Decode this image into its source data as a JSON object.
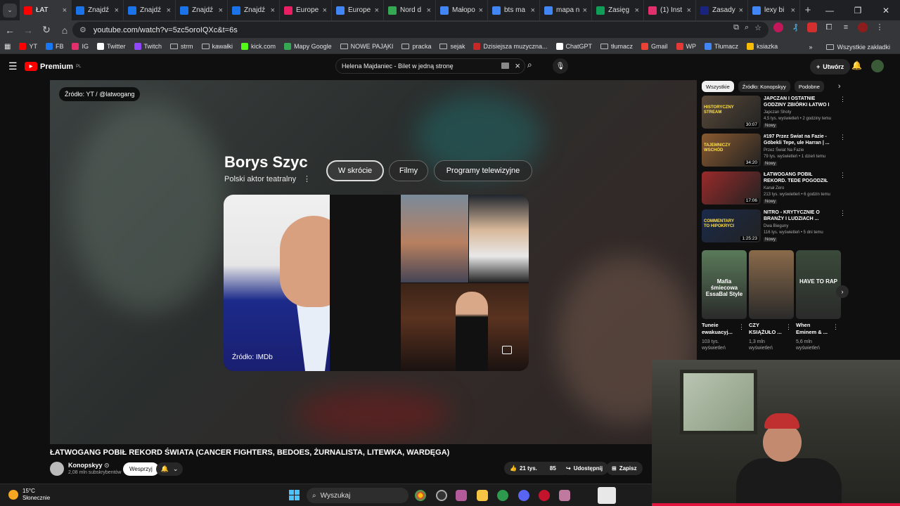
{
  "browser": {
    "tabs": [
      {
        "label": "ŁAT",
        "color": "#ff0000",
        "active": true
      },
      {
        "label": "Znajdź",
        "color": "#1a73e8"
      },
      {
        "label": "Znajdź",
        "color": "#1a73e8"
      },
      {
        "label": "Znajdź",
        "color": "#1a73e8"
      },
      {
        "label": "Znajdź",
        "color": "#1a73e8"
      },
      {
        "label": "Europe",
        "color": "#e91e63"
      },
      {
        "label": "Europe",
        "color": "#4285f4"
      },
      {
        "label": "Nord d",
        "color": "#34a853"
      },
      {
        "label": "Małopo",
        "color": "#4285f4"
      },
      {
        "label": "bts ma",
        "color": "#4285f4"
      },
      {
        "label": "mapa n",
        "color": "#4285f4"
      },
      {
        "label": "Zasięg",
        "color": "#0f9d58"
      },
      {
        "label": "(1) Inst",
        "color": "#e1306c"
      },
      {
        "label": "Zasady",
        "color": "#1a237e"
      },
      {
        "label": "lexy bi",
        "color": "#4285f4"
      }
    ],
    "url": "youtube.com/watch?v=5zc5oroIQXc&t=6s",
    "bookmarks": [
      {
        "label": "YT",
        "color": "#ff0000"
      },
      {
        "label": "FB",
        "color": "#1877f2"
      },
      {
        "label": "IG",
        "color": "#e1306c"
      },
      {
        "label": "Twitter",
        "color": "#ffffff"
      },
      {
        "label": "Twitch",
        "color": "#9146ff"
      },
      {
        "label": "strm",
        "color": "folder"
      },
      {
        "label": "kawałki",
        "color": "folder"
      },
      {
        "label": "kick.com",
        "color": "#53fc18"
      },
      {
        "label": "Mapy Google",
        "color": "#34a853"
      },
      {
        "label": "NOWE PAJĄKI",
        "color": "folder"
      },
      {
        "label": "pracka",
        "color": "folder"
      },
      {
        "label": "sejak",
        "color": "folder"
      },
      {
        "label": "Dzisiejsza muzyczna...",
        "color": "#c62828"
      },
      {
        "label": "ChatGPT",
        "color": "#ffffff"
      },
      {
        "label": "tłumacz",
        "color": "folder"
      },
      {
        "label": "Gmail",
        "color": "#ea4335"
      },
      {
        "label": "WP",
        "color": "#e53935"
      },
      {
        "label": "Tłumacz",
        "color": "#4285f4"
      },
      {
        "label": "ksiazka",
        "color": "#fbbc04"
      }
    ],
    "all_bookmarks": "Wszystkie zakładki"
  },
  "youtube": {
    "logo_text": "Premium",
    "logo_sup": "PL",
    "search_value": "Helena Majdaniec - Bilet w jedną stronę",
    "create_label": "Utwórz"
  },
  "player": {
    "source_chip": "Źródło: YT / @latwogang",
    "knowledge_panel": {
      "name": "Borys Szyc",
      "description": "Polski aktor teatralny",
      "tabs": [
        "W skrócie",
        "Filmy",
        "Programy telewizyjne"
      ],
      "image_caption": "Źródło: IMDb"
    }
  },
  "video": {
    "title": "ŁATWOGANG POBIŁ REKORD ŚWIATA (CANCER FIGHTERS, BEDOES, ŻURNALISTA, LITEWKA, WARDĘGA)",
    "channel": "Konopskyy",
    "subscribers": "2,08 mln subskrybentów",
    "support_label": "Wesprzyj",
    "likes": "21 tys.",
    "dislikes": "85",
    "share_label": "Udostępnij",
    "save_label": "Zapisz"
  },
  "sidebar": {
    "filters": [
      "Wszystkie",
      "Źródło: Konopskyy",
      "Podobne"
    ],
    "recommendations": [
      {
        "title": "JAPCZAN I OSTATNIE GODZINY ZBIÓRKI ŁATWO I BEDOESA |",
        "channel": "Japczan Shoty",
        "views": "4,5 tys. wyświetleń • 2 godziny temu",
        "badge": "Nowy",
        "duration": "30:07",
        "thumb": "#5a4a3a",
        "thumb_text": "HISTORYCZNY STREAM"
      },
      {
        "title": "#197 Przez Świat na Fazie - Göbekli Tepe, ule Harran | ...",
        "channel": "Przez Świat Na Fazie",
        "views": "79 tys. wyświetleń • 1 dzień temu",
        "badge": "Nowy",
        "duration": "34:20",
        "thumb": "#8a5a30",
        "thumb_text": "TAJEMNICZY WSCHÓD"
      },
      {
        "title": "ŁATWOGANG POBIŁ REKORD. TEDE POGODZIŁ SIĘ Z PEJĄ, ...",
        "channel": "Kanał Zero",
        "views": "213 tys. wyświetleń • 6 godzin temu",
        "badge": "Nowy",
        "duration": "17:06",
        "thumb": "#9a2a2a",
        "thumb_text": ""
      },
      {
        "title": "NITRO - KRYTYCZNIE O BRANŻY I LUDZIACH ...",
        "channel": "Dwa Bieguny",
        "views": "116 tys. wyświetleń • 5 dni temu",
        "badge": "Nowy",
        "duration": "1:25:23",
        "thumb": "#1a2a4a",
        "thumb_text": "COMMENTARY TO HIPOKRYCI"
      }
    ],
    "shorts": [
      {
        "title": "Tuneie ewakuacyj...",
        "views": "103 tys. wyświetleń",
        "color": "#5a7a5a",
        "overlay": "Mafia śmiecowa EssaBal Style"
      },
      {
        "title": "CZY KSIĄŻUŁO ...",
        "views": "1,3 mln wyświetleń",
        "color": "#8a6a4a",
        "overlay": ""
      },
      {
        "title": "When Eminem & ...",
        "views": "5,6 mln wyświetleń",
        "color": "#3a4a3a",
        "overlay": "HAVE TO RAP"
      }
    ]
  },
  "taskbar": {
    "temperature": "15°C",
    "weather": "Słonecznie",
    "search_placeholder": "Wyszukaj"
  }
}
